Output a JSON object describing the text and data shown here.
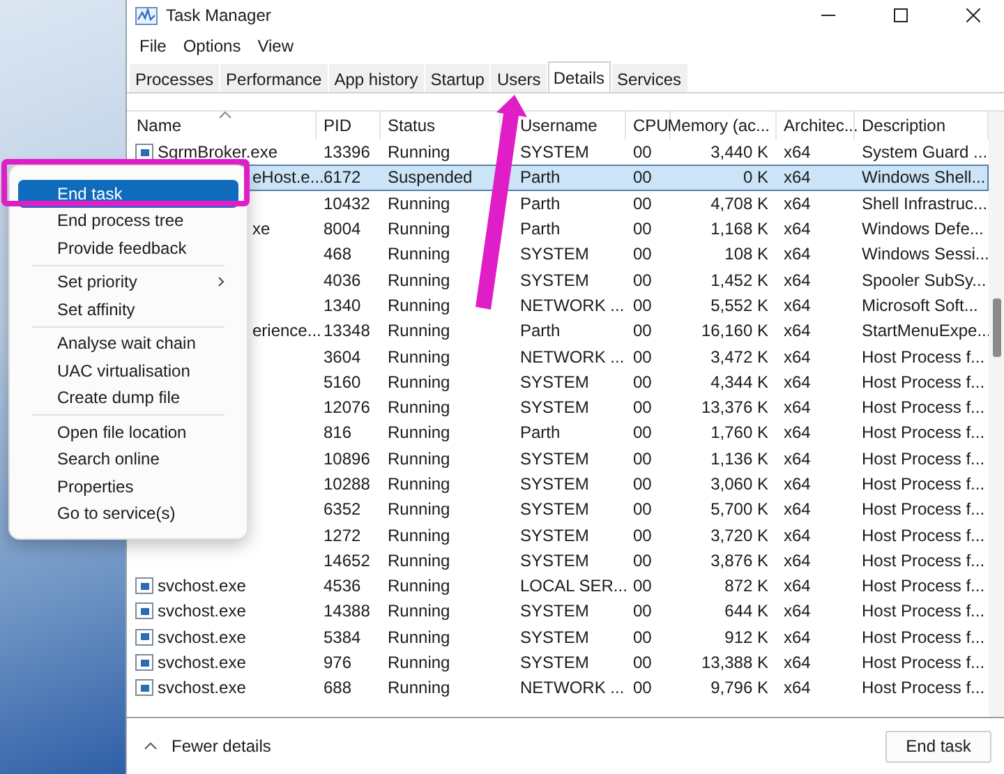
{
  "window": {
    "title": "Task Manager"
  },
  "menu_bar": [
    "File",
    "Options",
    "View"
  ],
  "tabs": [
    {
      "label": "Processes",
      "selected": false
    },
    {
      "label": "Performance",
      "selected": false
    },
    {
      "label": "App history",
      "selected": false
    },
    {
      "label": "Startup",
      "selected": false
    },
    {
      "label": "Users",
      "selected": false
    },
    {
      "label": "Details",
      "selected": true
    },
    {
      "label": "Services",
      "selected": false
    }
  ],
  "table": {
    "columns": [
      "Name",
      "PID",
      "Status",
      "Username",
      "CPU",
      "Memory (ac...",
      "Architec...",
      "Description"
    ],
    "rows": [
      {
        "name": "SgrmBroker.exe",
        "covered": false,
        "pid": "13396",
        "status": "Running",
        "user": "SYSTEM",
        "cpu": "00",
        "memory": "3,440 K",
        "arch": "x64",
        "description": "System Guard ...",
        "selected": false
      },
      {
        "name": "eHost.e...",
        "covered": true,
        "pid": "6172",
        "status": "Suspended",
        "user": "Parth",
        "cpu": "00",
        "memory": "0 K",
        "arch": "x64",
        "description": "Windows Shell...",
        "selected": true
      },
      {
        "pid": "10432",
        "status": "Running",
        "user": "Parth",
        "cpu": "00",
        "memory": "4,708 K",
        "arch": "x64",
        "description": "Shell Infrastruc...",
        "selected": false
      },
      {
        "name": "xe",
        "covered": true,
        "pid": "8004",
        "status": "Running",
        "user": "Parth",
        "cpu": "00",
        "memory": "1,168 K",
        "arch": "x64",
        "description": "Windows Defe...",
        "selected": false
      },
      {
        "pid": "468",
        "status": "Running",
        "user": "SYSTEM",
        "cpu": "00",
        "memory": "108 K",
        "arch": "x64",
        "description": "Windows Sessi...",
        "selected": false
      },
      {
        "pid": "4036",
        "status": "Running",
        "user": "SYSTEM",
        "cpu": "00",
        "memory": "1,452 K",
        "arch": "x64",
        "description": "Spooler SubSy...",
        "selected": false
      },
      {
        "pid": "1340",
        "status": "Running",
        "user": "NETWORK ...",
        "cpu": "00",
        "memory": "5,552 K",
        "arch": "x64",
        "description": "Microsoft Soft...",
        "selected": false
      },
      {
        "name": "erience...",
        "covered": true,
        "pid": "13348",
        "status": "Running",
        "user": "Parth",
        "cpu": "00",
        "memory": "16,160 K",
        "arch": "x64",
        "description": "StartMenuExpe...",
        "selected": false
      },
      {
        "pid": "3604",
        "status": "Running",
        "user": "NETWORK ...",
        "cpu": "00",
        "memory": "3,472 K",
        "arch": "x64",
        "description": "Host Process f...",
        "selected": false
      },
      {
        "pid": "5160",
        "status": "Running",
        "user": "SYSTEM",
        "cpu": "00",
        "memory": "4,344 K",
        "arch": "x64",
        "description": "Host Process f...",
        "selected": false
      },
      {
        "pid": "12076",
        "status": "Running",
        "user": "SYSTEM",
        "cpu": "00",
        "memory": "13,376 K",
        "arch": "x64",
        "description": "Host Process f...",
        "selected": false
      },
      {
        "pid": "816",
        "status": "Running",
        "user": "Parth",
        "cpu": "00",
        "memory": "1,760 K",
        "arch": "x64",
        "description": "Host Process f...",
        "selected": false
      },
      {
        "pid": "10896",
        "status": "Running",
        "user": "SYSTEM",
        "cpu": "00",
        "memory": "1,136 K",
        "arch": "x64",
        "description": "Host Process f...",
        "selected": false
      },
      {
        "pid": "10288",
        "status": "Running",
        "user": "SYSTEM",
        "cpu": "00",
        "memory": "3,060 K",
        "arch": "x64",
        "description": "Host Process f...",
        "selected": false
      },
      {
        "pid": "6352",
        "status": "Running",
        "user": "SYSTEM",
        "cpu": "00",
        "memory": "5,700 K",
        "arch": "x64",
        "description": "Host Process f...",
        "selected": false
      },
      {
        "pid": "1272",
        "status": "Running",
        "user": "SYSTEM",
        "cpu": "00",
        "memory": "3,720 K",
        "arch": "x64",
        "description": "Host Process f...",
        "selected": false
      },
      {
        "pid": "14652",
        "status": "Running",
        "user": "SYSTEM",
        "cpu": "00",
        "memory": "3,876 K",
        "arch": "x64",
        "description": "Host Process f...",
        "selected": false
      },
      {
        "name": "svchost.exe",
        "covered": false,
        "pid": "4536",
        "status": "Running",
        "user": "LOCAL SER...",
        "cpu": "00",
        "memory": "872 K",
        "arch": "x64",
        "description": "Host Process f...",
        "selected": false
      },
      {
        "name": "svchost.exe",
        "covered": false,
        "pid": "14388",
        "status": "Running",
        "user": "SYSTEM",
        "cpu": "00",
        "memory": "644 K",
        "arch": "x64",
        "description": "Host Process f...",
        "selected": false
      },
      {
        "name": "svchost.exe",
        "covered": false,
        "pid": "5384",
        "status": "Running",
        "user": "SYSTEM",
        "cpu": "00",
        "memory": "912 K",
        "arch": "x64",
        "description": "Host Process f...",
        "selected": false
      },
      {
        "name": "svchost.exe",
        "covered": false,
        "pid": "976",
        "status": "Running",
        "user": "SYSTEM",
        "cpu": "00",
        "memory": "13,388 K",
        "arch": "x64",
        "description": "Host Process f...",
        "selected": false
      },
      {
        "name": "svchost.exe",
        "covered": false,
        "pid": "688",
        "status": "Running",
        "user": "NETWORK ...",
        "cpu": "00",
        "memory": "9,796 K",
        "arch": "x64",
        "description": "Host Process f...",
        "selected": false
      }
    ]
  },
  "context_menu": [
    {
      "kind": "item",
      "label": "End task",
      "selected": true
    },
    {
      "kind": "item",
      "label": "End process tree",
      "selected": false
    },
    {
      "kind": "item",
      "label": "Provide feedback",
      "selected": false
    },
    {
      "kind": "separator"
    },
    {
      "kind": "submenu",
      "label": "Set priority",
      "selected": false
    },
    {
      "kind": "item",
      "label": "Set affinity",
      "selected": false
    },
    {
      "kind": "separator"
    },
    {
      "kind": "item",
      "label": "Analyse wait chain",
      "selected": false
    },
    {
      "kind": "item",
      "label": "UAC virtualisation",
      "selected": false
    },
    {
      "kind": "item",
      "label": "Create dump file",
      "selected": false
    },
    {
      "kind": "separator"
    },
    {
      "kind": "item",
      "label": "Open file location",
      "selected": false
    },
    {
      "kind": "item",
      "label": "Search online",
      "selected": false
    },
    {
      "kind": "item",
      "label": "Properties",
      "selected": false
    },
    {
      "kind": "item",
      "label": "Go to service(s)",
      "selected": false
    }
  ],
  "footer": {
    "toggle": "Fewer details",
    "button": "End task"
  }
}
